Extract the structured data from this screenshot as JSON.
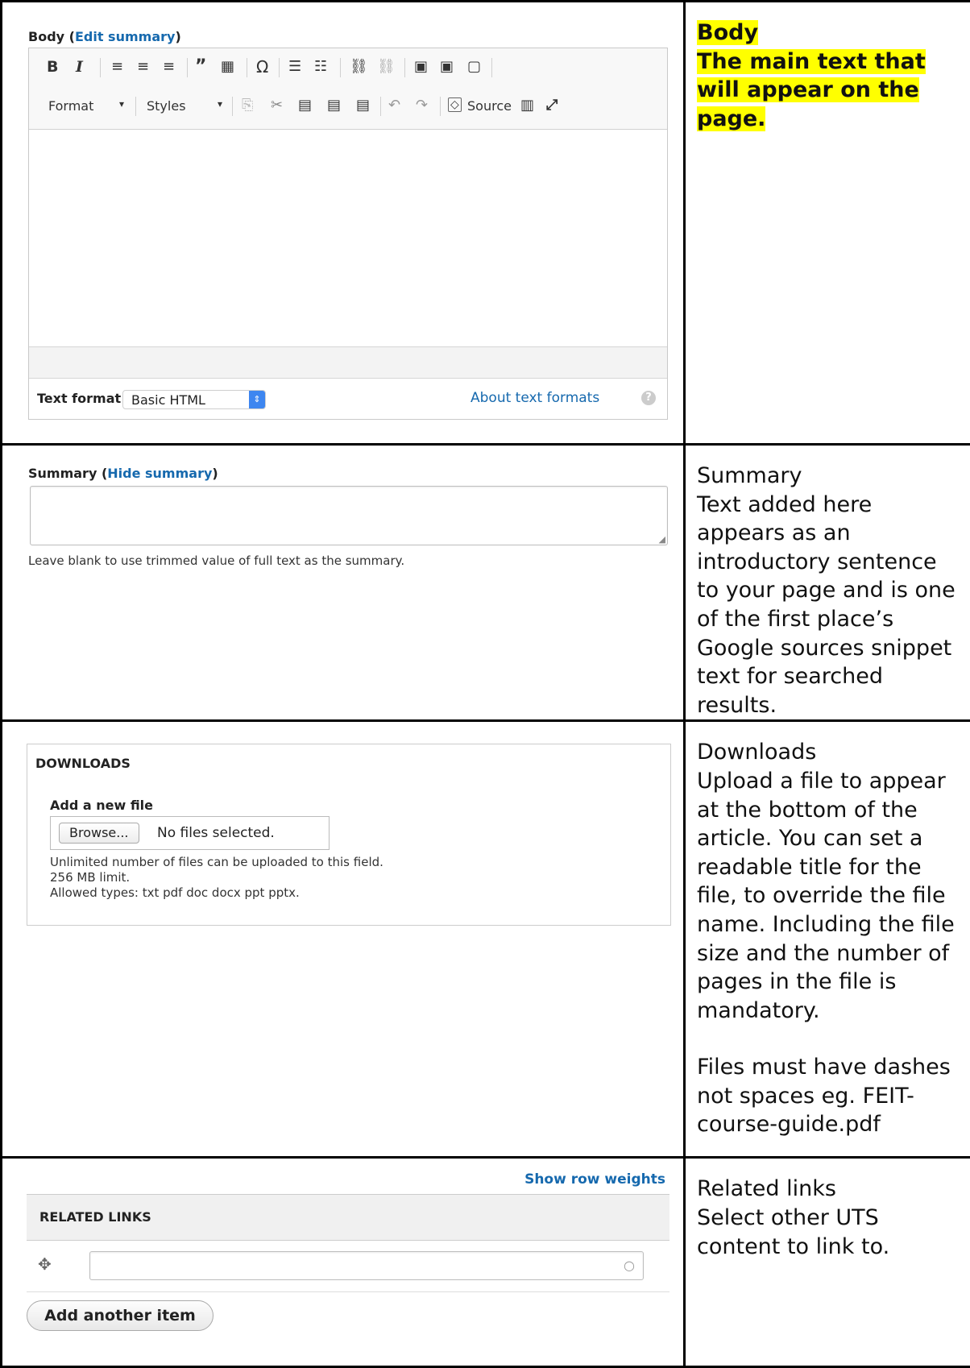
{
  "body_section": {
    "label": "Body",
    "edit_summary_link": "Edit summary",
    "toolbar": {
      "bold": "B",
      "italic": "I",
      "format_label": "Format",
      "styles_label": "Styles",
      "source_label": "Source"
    },
    "text_format_label": "Text format",
    "text_format_value": "Basic HTML",
    "about_formats_link": "About text formats",
    "note_title": "Body",
    "note_text": "The main text that will appear on the page."
  },
  "summary_section": {
    "label": "Summary",
    "hide_summary_link": "Hide summary",
    "help_text": "Leave blank to use trimmed value of full text as the summary.",
    "note_title": "Summary",
    "note_text": "Text added here appears as an introductory sentence to your page and is one of the first place’s Google sources snippet text for searched results."
  },
  "downloads_section": {
    "legend": "DOWNLOADS",
    "add_file_label": "Add a new file",
    "browse_button": "Browse...",
    "no_files_text": "No files selected.",
    "help_line1": "Unlimited number of files can be uploaded to this field.",
    "help_line2": "256 MB limit.",
    "help_line3": "Allowed types: txt pdf doc docx ppt pptx.",
    "note_title": "Downloads",
    "note_text": "Upload a file to appear at the bottom of the article. You can set a readable title for the file, to override the file name. Including the file size and the number of pages in the file is mandatory.",
    "note_text2": "Files must have dashes not spaces eg. FEIT-course-guide.pdf"
  },
  "related_section": {
    "show_row_weights_link": "Show row weights",
    "header": "RELATED LINKS",
    "add_another_button": "Add another item",
    "note_title": "Related links",
    "note_text": "Select other UTS content to link to."
  }
}
